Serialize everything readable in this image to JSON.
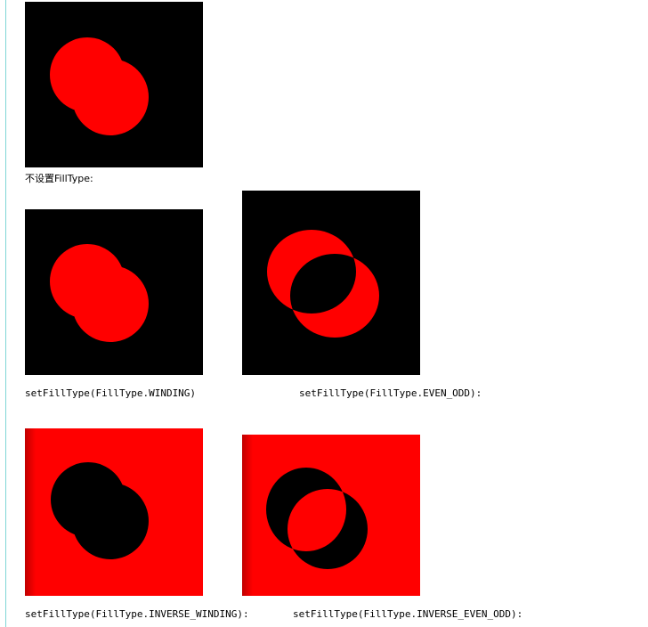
{
  "captions": {
    "no_fill_type": "不设置FillType:",
    "winding": "setFillType(FillType.WINDING)",
    "even_odd": "setFillType(FillType.EVEN_ODD):",
    "inverse_winding": "setFillType(FillType.INVERSE_WINDING):",
    "inverse_even_odd": "setFillType(FillType.INVERSE_EVEN_ODD):"
  },
  "colors": {
    "background": "#000000",
    "fill": "#ff0000",
    "rule": "#7fd6d6"
  }
}
